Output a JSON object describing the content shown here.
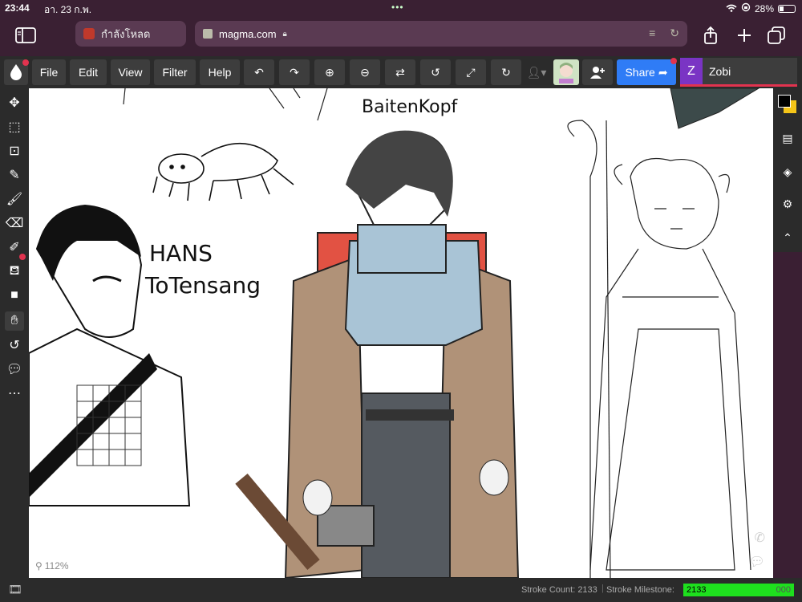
{
  "status_bar": {
    "time": "23:44",
    "date": "อา. 23 ก.พ.",
    "battery": "28%"
  },
  "browser": {
    "tab_title": "กำลังโหลด",
    "url": "magma.com"
  },
  "toolbar": {
    "menus": [
      "File",
      "Edit",
      "View",
      "Filter",
      "Help"
    ],
    "share_label": "Share",
    "user_initial": "Z",
    "user_name": "Zobi"
  },
  "canvas": {
    "zoom": "112%",
    "texts": {
      "title_top": "BaitenKopf",
      "name_line1": "HANS",
      "name_line2": "ToTensang"
    }
  },
  "footer": {
    "stroke_count_label": "Stroke Count: 2133",
    "stroke_milestone_label": "Stroke Milestone:",
    "milestone_value": "2133",
    "milestone_target": "000",
    "milestone_progress": 1.0
  },
  "colors": {
    "primary_swatch": "#000000",
    "secondary_swatch": "#f5c518",
    "share": "#2f7cf6",
    "user_accent": "#e2334f"
  }
}
